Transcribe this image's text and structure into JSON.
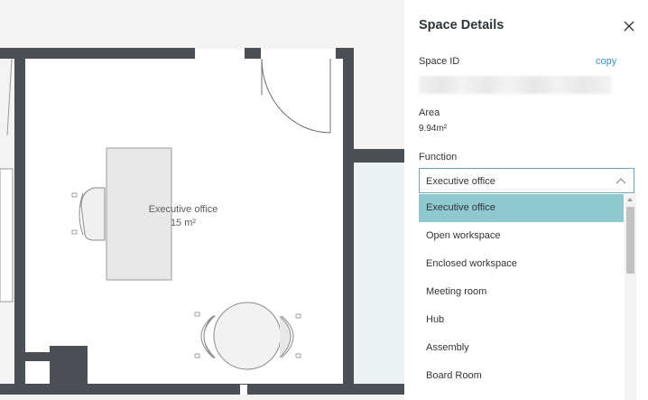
{
  "panel": {
    "title": "Space Details",
    "space_id_label": "Space ID",
    "copy_label": "copy",
    "area_label": "Area",
    "area_value": "9.94m²",
    "function_label": "Function",
    "function_selected": "Executive office",
    "options": [
      "Executive office",
      "Open workspace",
      "Enclosed workspace",
      "Meeting room",
      "Hub",
      "Assembly",
      "Board Room"
    ]
  },
  "room": {
    "name": "Executive office",
    "capacity": "15 m²"
  },
  "colors": {
    "wall": "#4a5056",
    "selected_option": "#8fc9cf",
    "link": "#3b8fc6"
  }
}
